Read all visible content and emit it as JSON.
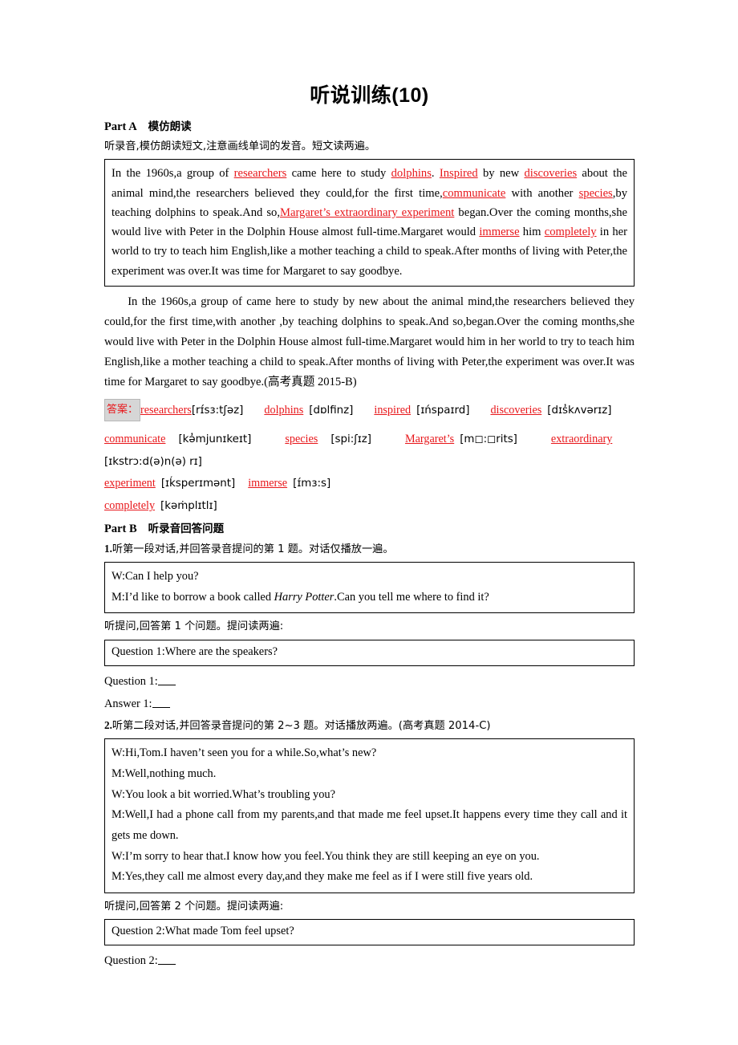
{
  "title": "听说训练(10)",
  "partA": {
    "label": "Part A",
    "zh_label": "模仿朗读",
    "instruction": "听录音,模仿朗读短文,注意画线单词的发音。短文读两遍。",
    "passage_segments": [
      {
        "t": "In the 1960s,a group of ",
        "s": "plain"
      },
      {
        "t": "researchers",
        "s": "red"
      },
      {
        "t": " came here to study ",
        "s": "plain"
      },
      {
        "t": "dolphins",
        "s": "red"
      },
      {
        "t": ". ",
        "s": "plain"
      },
      {
        "t": "Inspired",
        "s": "red"
      },
      {
        "t": " by new ",
        "s": "plain"
      },
      {
        "t": "discoveries",
        "s": "red"
      },
      {
        "t": " about the animal mind,the researchers believed they could,for the first time,",
        "s": "plain"
      },
      {
        "t": "communicate",
        "s": "red"
      },
      {
        "t": " with another ",
        "s": "plain"
      },
      {
        "t": "species",
        "s": "red"
      },
      {
        "t": ",by teaching dolphins to speak.And so,",
        "s": "plain"
      },
      {
        "t": "Margaret’s extraordinary experiment",
        "s": "red"
      },
      {
        "t": " began.Over the coming months,she would live with Peter in the Dolphin House almost full-time.Margaret would ",
        "s": "plain"
      },
      {
        "t": "immerse",
        "s": "red"
      },
      {
        "t": " him ",
        "s": "plain"
      },
      {
        "t": "completely",
        "s": "red"
      },
      {
        "t": " in her world to try to teach him English,like a mother teaching a child to speak.After months of living with Peter,the experiment was over.It was time for Margaret to say goodbye.",
        "s": "plain"
      }
    ],
    "blank_passage": "In the 1960s,a group of  came here to study  by new  about the animal mind,the researchers believed they could,for the first time,with another  ,by teaching dolphins to speak.And so,began.Over the coming months,she would live with Peter in the Dolphin House almost full-time.Margaret would  him in her world to try to teach him English,like a mother teaching a child to speak.After months of living with Peter,the experiment was over.It was time for Margaret to say goodbye.(高考真题 2015-B)",
    "answer_tag": "答案：",
    "answers": [
      {
        "word": "researchers",
        "ipa": "[rɪ́sɜ:tʃəz]"
      },
      {
        "word": "dolphins",
        "ipa": "[dɒlfinz]"
      },
      {
        "word": "inspired",
        "ipa": "[ɪńspaɪrd]"
      },
      {
        "word": "discoveries",
        "ipa": "[dɪs̓kʌvərɪz]"
      },
      {
        "word": "communicate",
        "ipa": "[kə̓mjunɪkeɪt]"
      },
      {
        "word": "species",
        "ipa": "[spi:ʃɪz]"
      },
      {
        "word": "Margaret’s",
        "ipa": "[m◻:◻rits]"
      },
      {
        "word": "extraordinary",
        "ipa": "[ɪkstrɔ:d(ə)n(ə) rɪ]"
      },
      {
        "word": "experiment",
        "ipa": "[ɪḱsperɪmənt]"
      },
      {
        "word": "immerse",
        "ipa": "[ɪ́mɜ:s]"
      },
      {
        "word": "completely",
        "ipa": "[kəṁplɪtlɪ]"
      }
    ]
  },
  "partB": {
    "label": "Part B",
    "zh_label": "听录音回答问题",
    "q1": {
      "instruction_num": "1.",
      "instruction": "听第一段对话,并回答录音提问的第 1 题。对话仅播放一遍。",
      "dialog": [
        {
          "speaker": "W:",
          "pre": "Can I help you?",
          "italic": "",
          "post": ""
        },
        {
          "speaker": "M:",
          "pre": "I’d like to borrow a book called ",
          "italic": "Harry Potter",
          "post": ".Can you tell me where to find it?"
        }
      ],
      "listen_prompt": "听提问,回答第 1 个问题。提问读两遍:",
      "question_box": "Question 1:Where are the speakers?",
      "question_label": "Question 1:",
      "answer_label": "Answer 1:"
    },
    "q2": {
      "instruction_num": "2.",
      "instruction": "听第二段对话,并回答录音提问的第 2~3 题。对话播放两遍。(高考真题 2014-C)",
      "dialog": [
        {
          "speaker": "W:",
          "pre": "Hi,Tom.I haven’t seen you for a while.So,what’s new?",
          "italic": "",
          "post": ""
        },
        {
          "speaker": "M:",
          "pre": "Well,nothing much.",
          "italic": "",
          "post": ""
        },
        {
          "speaker": "W:",
          "pre": "You look a bit worried.What’s troubling you?",
          "italic": "",
          "post": ""
        },
        {
          "speaker": "M:",
          "pre": "Well,I had a phone call from my parents,and that made me feel upset.It happens every time they call and it gets me down.",
          "italic": "",
          "post": ""
        },
        {
          "speaker": "W:",
          "pre": "I’m sorry to hear that.I know how you feel.You think they are still keeping an eye on you.",
          "italic": "",
          "post": ""
        },
        {
          "speaker": "M:",
          "pre": "Yes,they call me almost every day,and they make me feel as if I were still five years old.",
          "italic": "",
          "post": ""
        }
      ],
      "listen_prompt": "听提问,回答第 2 个问题。提问读两遍:",
      "question_box": "Question 2:What made Tom feel upset?",
      "question_label": "Question 2:"
    }
  },
  "colors": {
    "red": "#e8171b",
    "answer_tag_bg": "#d6d6d6",
    "border": "#000000"
  }
}
